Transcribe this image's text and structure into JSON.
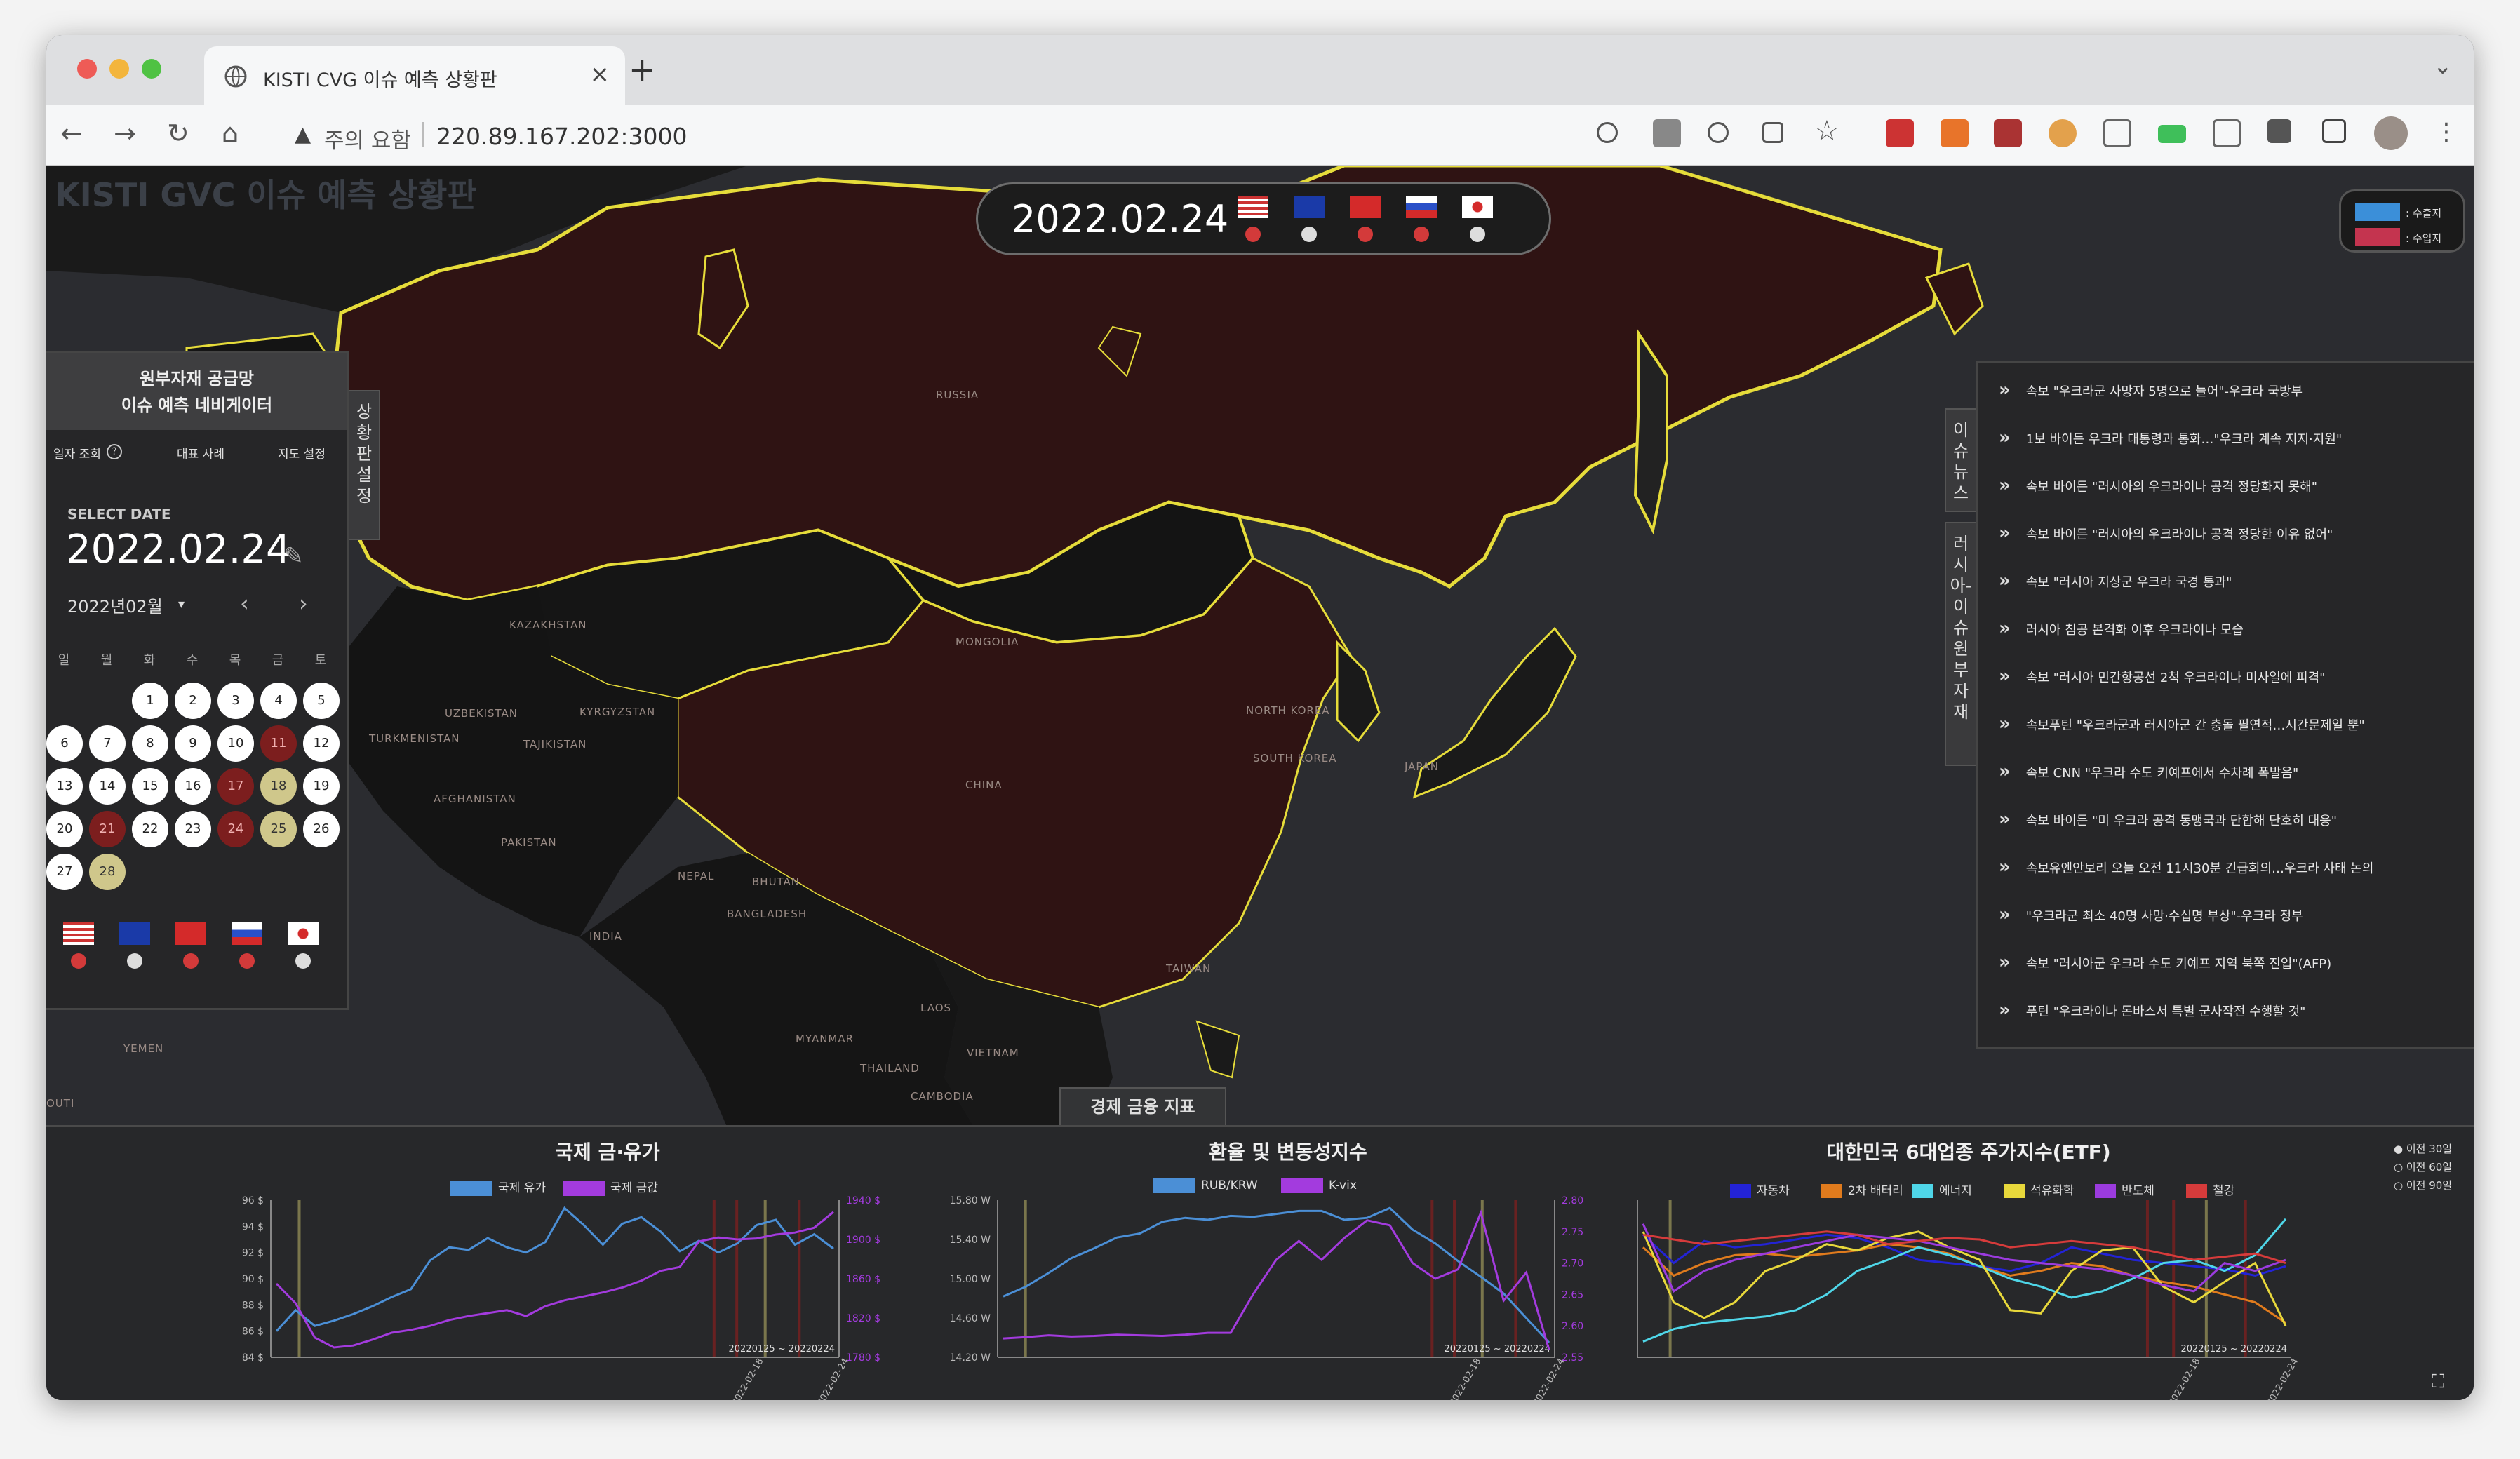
{
  "browser": {
    "tab_title": "KISTI CVG 이슈 예측 상황판",
    "address_warning": "주의 요함",
    "url": "220.89.167.202:3000"
  },
  "app": {
    "title": "KISTI GVC 이슈 예측 상황판"
  },
  "date_bar": {
    "date": "2022.02.24",
    "countries": [
      {
        "name": "USA",
        "flag": "us-flag",
        "status_color": "#d33a3a"
      },
      {
        "name": "EU",
        "flag": "eu-flag",
        "status_color": "#dddddd"
      },
      {
        "name": "China",
        "flag": "cn-flag",
        "status_color": "#d33a3a"
      },
      {
        "name": "Russia",
        "flag": "ru-flag",
        "status_color": "#d33a3a"
      },
      {
        "name": "Japan",
        "flag": "jp-flag",
        "status_color": "#dddddd"
      }
    ]
  },
  "legend": {
    "export_label": ": 수출지",
    "import_label": ": 수입지",
    "export_color": "#3b8fd9",
    "import_color": "#c4344f"
  },
  "map_labels": [
    "RUSSIA",
    "KAZAKHSTAN",
    "MONGOLIA",
    "UZBEKISTAN",
    "KYRGYZSTAN",
    "TURKMENISTAN",
    "TAJIKISTAN",
    "AFGHANISTAN",
    "PAKISTAN",
    "NORTH KOREA",
    "SOUTH KOREA",
    "JAPAN",
    "CHINA",
    "NEPAL",
    "BHUTAN",
    "BANGLADESH",
    "INDIA",
    "TAIWAN",
    "LAOS",
    "MYANMAR",
    "THAILAND",
    "VIETNAM",
    "CAMBODIA",
    "YEMEN",
    "OUTI"
  ],
  "navigator": {
    "header_line1": "원부자재 공급망",
    "header_line2": "이슈 예측 네비게이터",
    "tabs": [
      "일자 조회",
      "대표 사례",
      "지도 설정"
    ],
    "select_date_label": "SELECT DATE",
    "selected_date": "2022.02.24",
    "month": "2022년02월",
    "weekdays": [
      "일",
      "월",
      "화",
      "수",
      "목",
      "금",
      "토"
    ],
    "days": [
      "1",
      "2",
      "3",
      "4",
      "5",
      "6",
      "7",
      "8",
      "9",
      "10",
      "11",
      "12",
      "13",
      "14",
      "15",
      "16",
      "17",
      "18",
      "19",
      "20",
      "21",
      "22",
      "23",
      "24",
      "25",
      "26",
      "27",
      "28"
    ],
    "side_tab": "상황판설정"
  },
  "news": {
    "tab_news": "이슈뉴스",
    "tab_materials": "러시아-이슈원부자재",
    "items": [
      "속보 \"우크라군 사망자 5명으로 늘어\"-우크라 국방부",
      "1보 바이든 우크라 대통령과 통화…\"우크라 계속 지지·지원\"",
      "속보 바이든 \"러시아의 우크라이나 공격 정당화지 못해\"",
      "속보 바이든 \"러시아의 우크라이나 공격 정당한 이유 없어\"",
      "속보 \"러시아 지상군 우크라 국경 통과\"",
      "러시아 침공 본격화 이후 우크라이나 모습",
      "속보 \"러시아 민간항공선 2척 우크라이나 미사일에 피격\"",
      "속보푸틴 \"우크라군과 러시아군 간 충돌 필연적…시간문제일 뿐\"",
      "속보 CNN \"우크라 수도 키예프에서 수차례 폭발음\"",
      "속보 바이든 \"미 우크라 공격 동맹국과 단합해 단호히 대응\"",
      "속보유엔안보리 오늘 오전 11시30분 긴급회의…우크라 사태 논의",
      "\"우크라군 최소 40명 사망·수십명 부상\"-우크라 정부",
      "속보 \"러시아군 우크라 수도 키예프 지역 북쪽 진입\"(AFP)",
      "푸틴 \"우크라이나 돈바스서 특별 군사작전 수행할 것\""
    ]
  },
  "bottom": {
    "tab": "경제 금융 지표",
    "radio_options": [
      "이전 30일",
      "이전 60일",
      "이전 90일"
    ]
  },
  "chart_data": [
    {
      "type": "line",
      "title": "국제 금·유가",
      "range_label": "20220125 ~ 20220224",
      "x_ticks": [
        "2022-02-18",
        "2022-02-24"
      ],
      "y_left_ticks": [
        "96 $",
        "94 $",
        "92 $",
        "90 $",
        "88 $",
        "86 $",
        "84 $"
      ],
      "y_right_ticks": [
        "1940 $",
        "1900 $",
        "1860 $",
        "1820 $",
        "1780 $"
      ],
      "ylim_left": [
        84,
        96
      ],
      "ylim_right": [
        1780,
        1940
      ],
      "series": [
        {
          "name": "국제 유가",
          "color": "#4b8fd6",
          "axis": "left",
          "values": [
            86.0,
            87.6,
            86.4,
            86.8,
            87.3,
            87.9,
            88.6,
            89.2,
            91.4,
            92.4,
            92.2,
            93.1,
            92.4,
            92.0,
            92.8,
            95.4,
            94.1,
            92.6,
            94.2,
            94.7,
            93.6,
            92.1,
            92.9,
            92.0,
            92.7,
            94.1,
            94.5,
            92.6,
            93.4,
            92.3
          ]
        },
        {
          "name": "국제 금값",
          "color": "#a33bde",
          "axis": "right",
          "values": [
            1855,
            1835,
            1800,
            1790,
            1792,
            1798,
            1805,
            1808,
            1812,
            1818,
            1822,
            1825,
            1828,
            1822,
            1832,
            1838,
            1842,
            1846,
            1851,
            1858,
            1868,
            1872,
            1898,
            1902,
            1900,
            1901,
            1905,
            1907,
            1912,
            1928
          ]
        }
      ]
    },
    {
      "type": "line",
      "title": "환율 및 변동성지수",
      "range_label": "20220125 ~ 20220224",
      "x_ticks": [
        "2022-02-18",
        "2022-02-24"
      ],
      "y_left_ticks": [
        "15.80 W",
        "15.40 W",
        "15.00 W",
        "14.60 W",
        "14.20 W"
      ],
      "y_right_ticks": [
        "2.80",
        "2.75",
        "2.70",
        "2.65",
        "2.60",
        "2.55"
      ],
      "ylim_left": [
        14.2,
        15.8
      ],
      "ylim_right": [
        2.55,
        2.8
      ],
      "series": [
        {
          "name": "RUB/KRW",
          "color": "#4b8fd6",
          "axis": "left",
          "values": [
            14.82,
            14.92,
            15.06,
            15.21,
            15.31,
            15.42,
            15.46,
            15.58,
            15.62,
            15.6,
            15.64,
            15.63,
            15.66,
            15.69,
            15.69,
            15.6,
            15.62,
            15.72,
            15.5,
            15.36,
            15.18,
            15.02,
            14.85,
            14.6,
            14.35
          ]
        },
        {
          "name": "K-vix",
          "color": "#a33bde",
          "axis": "right",
          "values": [
            2.58,
            2.582,
            2.585,
            2.583,
            2.584,
            2.586,
            2.585,
            2.584,
            2.586,
            2.589,
            2.589,
            2.651,
            2.705,
            2.735,
            2.705,
            2.74,
            2.768,
            2.76,
            2.7,
            2.675,
            2.69,
            2.78,
            2.64,
            2.685,
            2.562
          ]
        }
      ]
    },
    {
      "type": "line",
      "title": "대한민국 6대업종 주가지수(ETF)",
      "range_label": "20220125 ~ 20220224",
      "x_ticks": [
        "2022-02-18",
        "2022-02-24"
      ],
      "ylim": [
        0,
        100
      ],
      "series": [
        {
          "name": "자동차",
          "color": "#2323d6",
          "values": [
            78,
            60,
            74,
            70,
            72,
            75,
            78,
            76,
            70,
            62,
            60,
            58,
            55,
            60,
            70,
            66,
            62,
            60,
            58,
            56,
            52,
            58
          ]
        },
        {
          "name": "2차 배터리",
          "color": "#e07b1d",
          "values": [
            70,
            52,
            60,
            65,
            66,
            64,
            66,
            68,
            72,
            70,
            66,
            58,
            52,
            55,
            60,
            58,
            52,
            48,
            45,
            40,
            35,
            22
          ]
        },
        {
          "name": "에너지",
          "color": "#4fd6e8",
          "values": [
            10,
            18,
            22,
            24,
            26,
            30,
            40,
            55,
            62,
            70,
            65,
            58,
            50,
            45,
            38,
            42,
            50,
            60,
            62,
            55,
            65,
            88
          ]
        },
        {
          "name": "석유화학",
          "color": "#e8d83b",
          "values": [
            80,
            35,
            25,
            35,
            55,
            62,
            72,
            68,
            76,
            80,
            70,
            62,
            30,
            28,
            55,
            68,
            70,
            45,
            35,
            48,
            60,
            20
          ]
        },
        {
          "name": "반도체",
          "color": "#9b3bde",
          "values": [
            85,
            42,
            55,
            62,
            66,
            70,
            74,
            78,
            76,
            74,
            70,
            66,
            62,
            60,
            58,
            56,
            52,
            46,
            42,
            60,
            55,
            62
          ]
        },
        {
          "name": "철강",
          "color": "#d63b3b",
          "values": [
            78,
            75,
            72,
            74,
            76,
            78,
            80,
            78,
            72,
            74,
            76,
            75,
            70,
            72,
            74,
            72,
            70,
            66,
            62,
            64,
            66,
            60
          ]
        }
      ]
    }
  ]
}
